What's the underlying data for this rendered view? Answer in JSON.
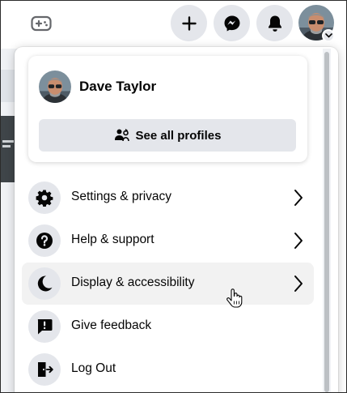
{
  "profile": {
    "name": "Dave Taylor",
    "see_all_label": "See all profiles"
  },
  "menu": {
    "items": [
      {
        "label": "Settings & privacy",
        "icon": "gear-icon",
        "has_chevron": true,
        "hover": false
      },
      {
        "label": "Help & support",
        "icon": "question-icon",
        "has_chevron": true,
        "hover": false
      },
      {
        "label": "Display & accessibility",
        "icon": "moon-icon",
        "has_chevron": true,
        "hover": true
      },
      {
        "label": "Give feedback",
        "icon": "feedback-icon",
        "has_chevron": false,
        "hover": false
      },
      {
        "label": "Log Out",
        "icon": "logout-icon",
        "has_chevron": false,
        "hover": false
      }
    ]
  },
  "topbar": {
    "icons": [
      "gaming-icon",
      "create-plus-icon",
      "messenger-icon",
      "notifications-bell-icon",
      "account-avatar"
    ]
  },
  "colors": {
    "button_bg": "#e4e6eb",
    "hover_bg": "#f2f2f2",
    "text": "#050505",
    "icon": "#050505"
  }
}
